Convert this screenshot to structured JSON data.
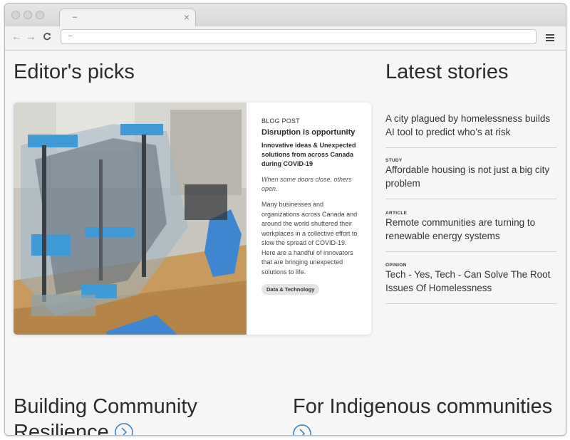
{
  "browser": {
    "tab_title": "–",
    "tab_close": "×",
    "url": "–",
    "back_glyph": "←",
    "forward_glyph": "→",
    "reload_glyph": "C"
  },
  "editors_picks": {
    "heading": "Editor's picks",
    "card": {
      "kicker": "BLOG POST",
      "title": "Disruption is opportunity",
      "subtitle": "Innovative ideas & Unexpected solutions from across Canada during COVID-19",
      "italic": "When some doors close, others open.",
      "description": "Many businesses and organizations across Canada and around the world shuttered their workplaces in a collective effort to slow the spread of COVID-19. Here are a handful of innovators that are bringing unexpected solutions to life.",
      "tag": "Data & Technology"
    }
  },
  "latest_stories": {
    "heading": "Latest stories",
    "items": [
      {
        "label": "",
        "title": "A city plagued by homelessness builds AI tool to predict who’s at risk"
      },
      {
        "label": "STUDY",
        "title": "Affordable housing is not just a big city problem"
      },
      {
        "label": "ARTICLE",
        "title": "Remote communities are turning to renewable energy systems"
      },
      {
        "label": "OPINION",
        "title": "Tech - Yes, Tech - Can Solve The Root Issues Of Homelessness"
      }
    ]
  },
  "sections": {
    "building_line1": "Building Community",
    "building_line2": "Resilience",
    "indigenous": "For Indigenous communities"
  },
  "colors": {
    "accent": "#2f7fc4",
    "page_bg": "#f6f6f7"
  },
  "icons": [
    "menu-icon",
    "arrow-circle-icon"
  ]
}
